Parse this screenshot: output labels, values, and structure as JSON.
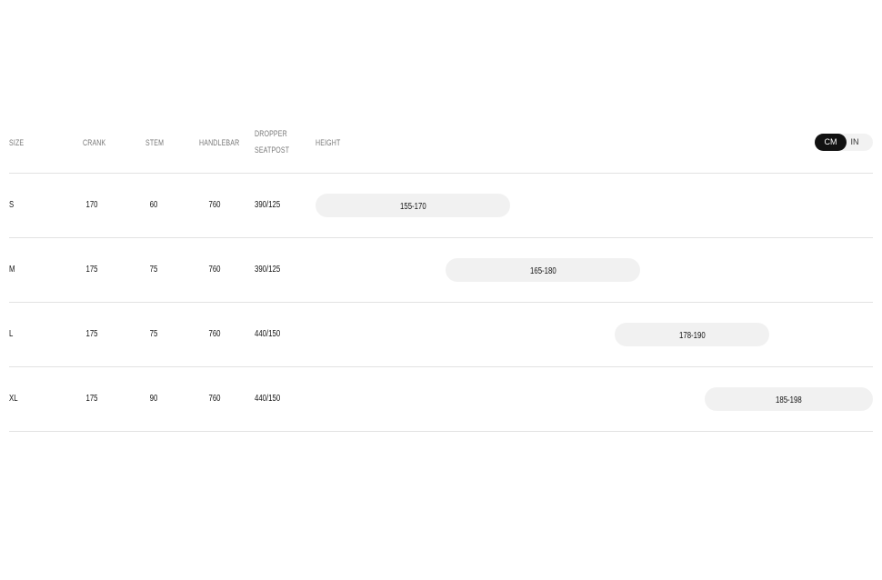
{
  "table": {
    "headers": {
      "size": "SIZE",
      "crank": "CRANK",
      "stem": "STEM",
      "handlebar": "HANDLEBAR",
      "dropper_line1": "DROPPER",
      "dropper_line2": "SEATPOST",
      "height": "HEIGHT"
    },
    "unit_toggle": {
      "active": "CM",
      "inactive": "IN"
    },
    "rows": [
      {
        "size": "S",
        "crank": "170",
        "stem": "60",
        "handlebar": "760",
        "dropper": "390/125",
        "height": "155-170",
        "height_min": 155,
        "height_max": 170
      },
      {
        "size": "M",
        "crank": "175",
        "stem": "75",
        "handlebar": "760",
        "dropper": "390/125",
        "height": "165-180",
        "height_min": 165,
        "height_max": 180
      },
      {
        "size": "L",
        "crank": "175",
        "stem": "75",
        "handlebar": "760",
        "dropper": "440/150",
        "height": "178-190",
        "height_min": 178,
        "height_max": 190
      },
      {
        "size": "XL",
        "crank": "175",
        "stem": "90",
        "handlebar": "760",
        "dropper": "440/150",
        "height": "185-198",
        "height_min": 185,
        "height_max": 198
      }
    ]
  },
  "colors": {
    "text": "#111111",
    "header_text": "#777777",
    "divider": "#e2e2e2",
    "pill_bg": "#f1f1f1",
    "toggle_active_bg": "#111111",
    "toggle_active_text": "#ffffff"
  }
}
